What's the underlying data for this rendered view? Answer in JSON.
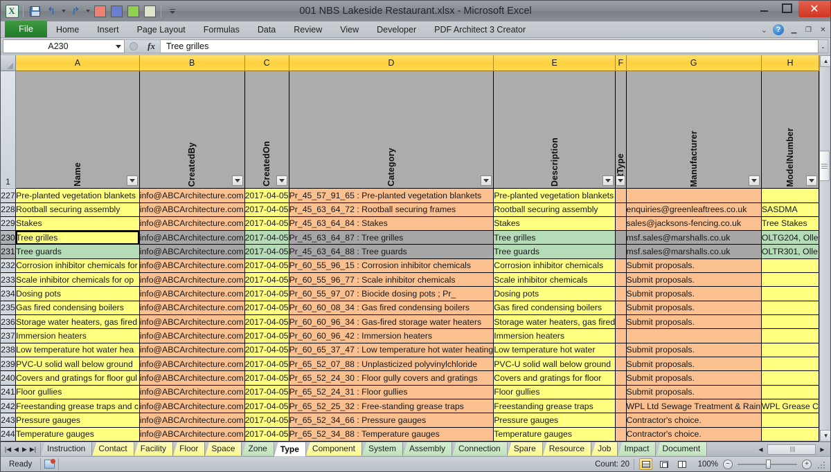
{
  "window": {
    "title": "001 NBS Lakeside Restaurant.xlsx  -  Microsoft Excel",
    "minimize_label": "",
    "maximize_label": "",
    "close_label": "✕"
  },
  "quick_access": {
    "logo_label": "X",
    "items": [
      "save-icon",
      "undo-icon",
      "redo-icon",
      "red-swatch",
      "blue-swatch",
      "green-swatch",
      "pale-swatch",
      "customize-icon"
    ]
  },
  "ribbon": {
    "file_tab": "File",
    "tabs": [
      "Home",
      "Insert",
      "Page Layout",
      "Formulas",
      "Data",
      "Review",
      "View",
      "Developer",
      "PDF Architect 3 Creator"
    ],
    "right_icons": [
      "ribbon-collapse-icon",
      "help-icon",
      "minimize-window-icon",
      "restore-window-icon",
      "close-window-icon"
    ]
  },
  "formula_bar": {
    "name_box_value": "A230",
    "formula_value": "Tree grilles",
    "fx_label": "fx"
  },
  "grid": {
    "column_letters": [
      "A",
      "B",
      "C",
      "D",
      "E",
      "F",
      "G",
      "H"
    ],
    "header_row_number": "1",
    "headers": [
      "Name",
      "CreatedBy",
      "CreatedOn",
      "Category",
      "Description",
      "setType",
      "Manufacturer",
      "ModelNumber"
    ],
    "active_cell": "A230",
    "selected_rows": [
      "230",
      "231"
    ],
    "rows": [
      {
        "num": "227",
        "cells": [
          "Pre-planted vegetation blankets",
          "info@ABCArchitecture.com",
          "2017-04-05",
          "Pr_45_57_91_65 : Pre-planted vegetation blankets",
          "Pre-planted vegetation blankets",
          "",
          "",
          ""
        ],
        "fills": [
          "yellow",
          "orange",
          "yellow",
          "orange",
          "yellow",
          "orange",
          "orange",
          "yellow"
        ]
      },
      {
        "num": "228",
        "cells": [
          "Rootball securing assembly",
          "info@ABCArchitecture.com",
          "2017-04-05",
          "Pr_45_63_64_72 : Rootball securing frames",
          "Rootball securing assembly",
          "",
          "enquiries@greenleaftrees.co.uk",
          "SASDMA"
        ],
        "fills": [
          "yellow",
          "orange",
          "yellow",
          "orange",
          "yellow",
          "orange",
          "orange",
          "yellow"
        ]
      },
      {
        "num": "229",
        "cells": [
          "Stakes",
          "info@ABCArchitecture.com",
          "2017-04-05",
          "Pr_45_63_64_84 : Stakes",
          "Stakes",
          "",
          "sales@jacksons-fencing.co.uk",
          "Tree Stakes"
        ],
        "fills": [
          "yellow",
          "orange",
          "yellow",
          "orange",
          "yellow",
          "orange",
          "orange",
          "yellow"
        ]
      },
      {
        "num": "230",
        "cells": [
          "Tree grilles",
          "info@ABCArchitecture.com",
          "2017-04-05",
          "Pr_45_63_64_87 : Tree grilles",
          "Tree grilles",
          "",
          "msf.sales@marshalls.co.uk",
          "OLTG204, Olle"
        ],
        "fills": [
          "yellow",
          "sel",
          "green",
          "sel",
          "green",
          "sel",
          "sel",
          "green"
        ],
        "selected": true
      },
      {
        "num": "231",
        "cells": [
          "Tree guards",
          "info@ABCArchitecture.com",
          "2017-04-05",
          "Pr_45_63_64_88 : Tree guards",
          "Tree guards",
          "",
          "msf.sales@marshalls.co.uk",
          "OLTR301, Olle"
        ],
        "fills": [
          "green",
          "sel",
          "green",
          "sel",
          "green",
          "sel",
          "sel",
          "green"
        ],
        "selected": true
      },
      {
        "num": "232",
        "cells": [
          "Corrosion inhibitor chemicals for",
          "info@ABCArchitecture.com",
          "2017-04-05",
          "Pr_60_55_96_15 : Corrosion inhibitor chemicals",
          "Corrosion inhibitor chemicals",
          "",
          "Submit proposals.",
          ""
        ],
        "fills": [
          "yellow",
          "orange",
          "yellow",
          "orange",
          "yellow",
          "orange",
          "orange",
          "yellow"
        ]
      },
      {
        "num": "233",
        "cells": [
          "Scale inhibitor chemicals for op",
          "info@ABCArchitecture.com",
          "2017-04-05",
          "Pr_60_55_96_77 : Scale inhibitor chemicals",
          "Scale inhibitor chemicals",
          "",
          "Submit proposals.",
          ""
        ],
        "fills": [
          "yellow",
          "orange",
          "yellow",
          "orange",
          "yellow",
          "orange",
          "orange",
          "yellow"
        ]
      },
      {
        "num": "234",
        "cells": [
          "Dosing pots",
          "info@ABCArchitecture.com",
          "2017-04-05",
          "Pr_60_55_97_07 : Biocide dosing pots ; Pr_",
          "Dosing pots",
          "",
          "Submit proposals.",
          ""
        ],
        "fills": [
          "yellow",
          "orange",
          "yellow",
          "orange",
          "yellow",
          "orange",
          "orange",
          "yellow"
        ]
      },
      {
        "num": "235",
        "cells": [
          "Gas fired condensing boilers",
          "info@ABCArchitecture.com",
          "2017-04-05",
          "Pr_60_60_08_34 : Gas fired condensing boilers",
          "Gas fired condensing boilers",
          "",
          "Submit proposals.",
          ""
        ],
        "fills": [
          "yellow",
          "orange",
          "yellow",
          "orange",
          "yellow",
          "orange",
          "orange",
          "yellow"
        ]
      },
      {
        "num": "236",
        "cells": [
          "Storage water heaters, gas fired",
          "info@ABCArchitecture.com",
          "2017-04-05",
          "Pr_60_60_96_34 : Gas-fired storage water heaters",
          "Storage water heaters, gas fired",
          "",
          "Submit proposals.",
          ""
        ],
        "fills": [
          "yellow",
          "orange",
          "yellow",
          "orange",
          "yellow",
          "orange",
          "orange",
          "yellow"
        ]
      },
      {
        "num": "237",
        "cells": [
          "Immersion heaters",
          "info@ABCArchitecture.com",
          "2017-04-05",
          "Pr_60_60_96_42 : Immersion heaters",
          "Immersion heaters",
          "",
          "",
          ""
        ],
        "fills": [
          "yellow",
          "orange",
          "yellow",
          "orange",
          "yellow",
          "orange",
          "orange",
          "yellow"
        ]
      },
      {
        "num": "238",
        "cells": [
          "Low temperature hot water hea",
          "info@ABCArchitecture.com",
          "2017-04-05",
          "Pr_60_65_37_47 : Low temperature hot water heating",
          "Low temperature hot water",
          "",
          "Submit proposals.",
          ""
        ],
        "fills": [
          "yellow",
          "orange",
          "yellow",
          "orange",
          "yellow",
          "orange",
          "orange",
          "yellow"
        ]
      },
      {
        "num": "239",
        "cells": [
          "PVC-U solid wall below ground",
          "info@ABCArchitecture.com",
          "2017-04-05",
          "Pr_65_52_07_88 : Unplasticized polyvinylchloride",
          "PVC-U solid wall below ground",
          "",
          "Submit proposals.",
          ""
        ],
        "fills": [
          "yellow",
          "orange",
          "yellow",
          "orange",
          "yellow",
          "orange",
          "orange",
          "yellow"
        ]
      },
      {
        "num": "240",
        "cells": [
          "Covers and gratings for floor gul",
          "info@ABCArchitecture.com",
          "2017-04-05",
          "Pr_65_52_24_30 : Floor gully covers and gratings",
          "Covers and gratings for floor",
          "",
          "Submit proposals.",
          ""
        ],
        "fills": [
          "yellow",
          "orange",
          "yellow",
          "orange",
          "yellow",
          "orange",
          "orange",
          "yellow"
        ]
      },
      {
        "num": "241",
        "cells": [
          "Floor gullies",
          "info@ABCArchitecture.com",
          "2017-04-05",
          "Pr_65_52_24_31 : Floor gullies",
          "Floor gullies",
          "",
          "Submit proposals.",
          ""
        ],
        "fills": [
          "yellow",
          "orange",
          "yellow",
          "orange",
          "yellow",
          "orange",
          "orange",
          "yellow"
        ]
      },
      {
        "num": "242",
        "cells": [
          "Freestanding grease traps and c",
          "info@ABCArchitecture.com",
          "2017-04-05",
          "Pr_65_52_25_32 : Free-standing grease traps",
          "Freestanding grease traps",
          "",
          "WPL Ltd Sewage Treatment & Rain",
          "WPL Grease C"
        ],
        "fills": [
          "yellow",
          "orange",
          "yellow",
          "orange",
          "yellow",
          "orange",
          "orange",
          "yellow"
        ]
      },
      {
        "num": "243",
        "cells": [
          "Pressure gauges",
          "info@ABCArchitecture.com",
          "2017-04-05",
          "Pr_65_52_34_66 : Pressure gauges",
          "Pressure gauges",
          "",
          "Contractor's choice.",
          ""
        ],
        "fills": [
          "yellow",
          "orange",
          "yellow",
          "orange",
          "yellow",
          "orange",
          "orange",
          "yellow"
        ]
      },
      {
        "num": "244",
        "cells": [
          "Temperature gauges",
          "info@ABCArchitecture.com",
          "2017-04-05",
          "Pr_65_52_34_88 : Temperature gauges",
          "Temperature gauges",
          "",
          "Contractor's choice.",
          ""
        ],
        "fills": [
          "yellow",
          "orange",
          "yellow",
          "orange",
          "yellow",
          "orange",
          "orange",
          "yellow"
        ]
      }
    ]
  },
  "sheet_tabs": {
    "nav_icons": [
      "first-sheet-icon",
      "prev-sheet-icon",
      "next-sheet-icon",
      "last-sheet-icon"
    ],
    "tabs": [
      {
        "label": "Instruction",
        "color": "gray",
        "active": false
      },
      {
        "label": "Contact",
        "color": "yellow",
        "active": false
      },
      {
        "label": "Facility",
        "color": "yellow",
        "active": false
      },
      {
        "label": "Floor",
        "color": "yellow",
        "active": false
      },
      {
        "label": "Space",
        "color": "yellow",
        "active": false
      },
      {
        "label": "Zone",
        "color": "green",
        "active": false
      },
      {
        "label": "Type",
        "color": "active",
        "active": true
      },
      {
        "label": "Component",
        "color": "yellow",
        "active": false
      },
      {
        "label": "System",
        "color": "green",
        "active": false
      },
      {
        "label": "Assembly",
        "color": "green",
        "active": false
      },
      {
        "label": "Connection",
        "color": "green",
        "active": false
      },
      {
        "label": "Spare",
        "color": "yellow",
        "active": false
      },
      {
        "label": "Resource",
        "color": "yellow",
        "active": false
      },
      {
        "label": "Job",
        "color": "yellow",
        "active": false
      },
      {
        "label": "Impact",
        "color": "green",
        "active": false
      },
      {
        "label": "Document",
        "color": "green",
        "active": false
      }
    ]
  },
  "status_bar": {
    "mode": "Ready",
    "count_label": "Count: 20",
    "zoom_label": "100%",
    "view_buttons": [
      "normal-view-icon",
      "page-layout-view-icon",
      "page-break-view-icon"
    ]
  }
}
